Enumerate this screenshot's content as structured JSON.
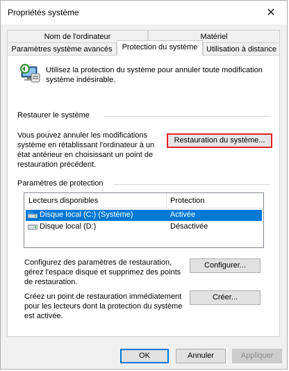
{
  "window": {
    "title": "Propriétés système",
    "close_glyph": "✕"
  },
  "tabs": {
    "row1": [
      "Nom de l'ordinateur",
      "Matériel"
    ],
    "row2": [
      "Paramètres système avancés",
      "Protection du système",
      "Utilisation à distance"
    ]
  },
  "intro": {
    "text": "Utilisez la protection du système pour annuler toute modification système indésirable.",
    "icon": "system-protection-icon"
  },
  "restore": {
    "heading": "Restaurer le système",
    "description": "Vous pouvez annuler les modifications système en rétablissant l'ordinateur à un état antérieur en choisissant un point de restauration précédent.",
    "button_label": "Restauration du système..."
  },
  "protection": {
    "heading": "Paramètres de protection",
    "columns": [
      "Lecteurs disponibles",
      "Protection"
    ],
    "rows": [
      {
        "drive": "Disque local (C:) (Système)",
        "status": "Activée",
        "selected": true,
        "icon": "system-drive-icon"
      },
      {
        "drive": "Disque local (D:)",
        "status": "Désactivée",
        "selected": false,
        "icon": "drive-icon"
      }
    ]
  },
  "configure": {
    "description": "Configurez des paramètres de restauration, gérez l'espace disque et supprimez des points de restauration.",
    "button_label": "Configurer..."
  },
  "create": {
    "description": "Créez un point de restauration immédiatement pour les lecteurs dont la protection du système est activée.",
    "button_label": "Créer..."
  },
  "footer": {
    "ok": "OK",
    "cancel": "Annuler",
    "apply": "Appliquer"
  },
  "colors": {
    "selection": "#0078d7",
    "highlight_border": "#e0242b",
    "panel": "#ffffff",
    "chrome": "#f0f0f0"
  }
}
